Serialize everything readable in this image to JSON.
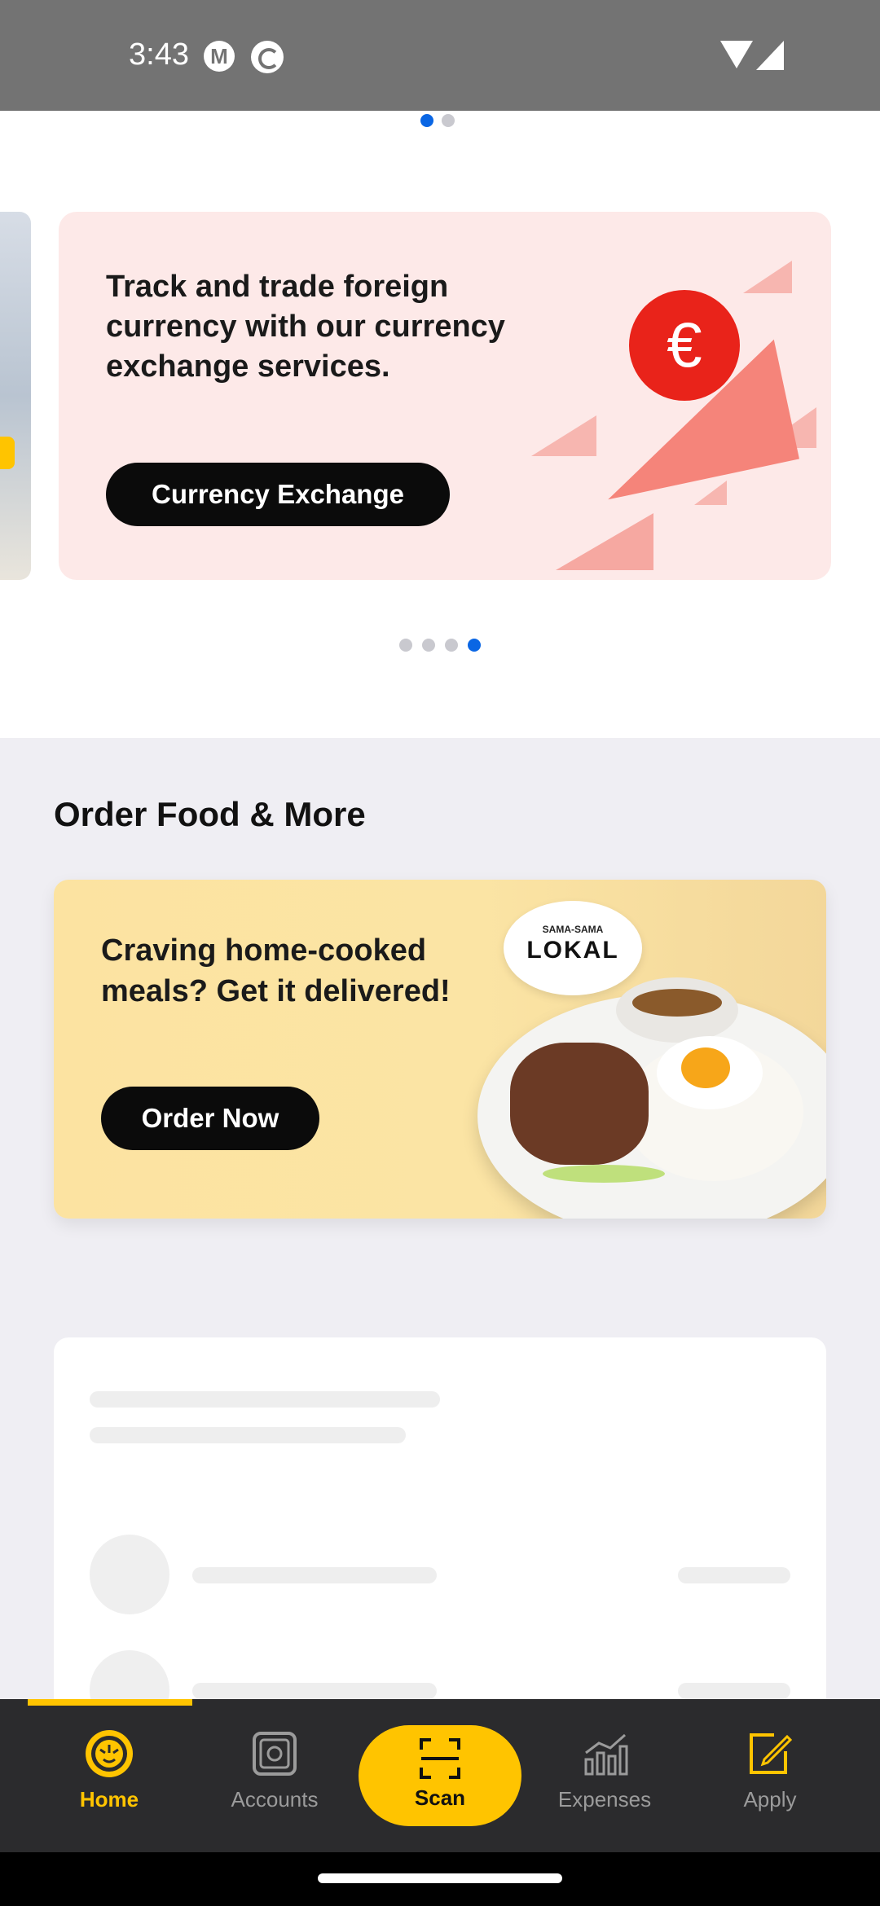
{
  "status_bar": {
    "time": "3:43",
    "icons": [
      "motorola-icon",
      "sync-icon",
      "wifi-icon",
      "signal-icon"
    ]
  },
  "carousel": {
    "dots_top_count": 2,
    "dots_top_active": 0,
    "banner": {
      "text": "Track and trade foreign currency with our currency exchange services.",
      "button_label": "Currency Exchange",
      "euro_symbol": "€"
    },
    "dots_count": 4,
    "dots_active": 3
  },
  "food_section": {
    "title": "Order Food & More",
    "card_text": "Craving home-cooked meals? Get it delivered!",
    "button_label": "Order Now",
    "logo_small": "SAMA-SAMA",
    "logo_big": "LOKAL"
  },
  "bottom_nav": {
    "items": [
      {
        "label": "Home",
        "icon": "tiger-icon",
        "active": true
      },
      {
        "label": "Accounts",
        "icon": "safe-icon",
        "active": false
      },
      {
        "label": "Scan",
        "icon": "scan-icon",
        "active": false
      },
      {
        "label": "Expenses",
        "icon": "chart-icon",
        "active": false
      },
      {
        "label": "Apply",
        "icon": "edit-icon",
        "active": false
      }
    ]
  },
  "colors": {
    "accent": "#ffc400",
    "active_dot": "#0a66e4",
    "nav_background": "#2b2b2d",
    "euro_red": "#e9231a"
  }
}
